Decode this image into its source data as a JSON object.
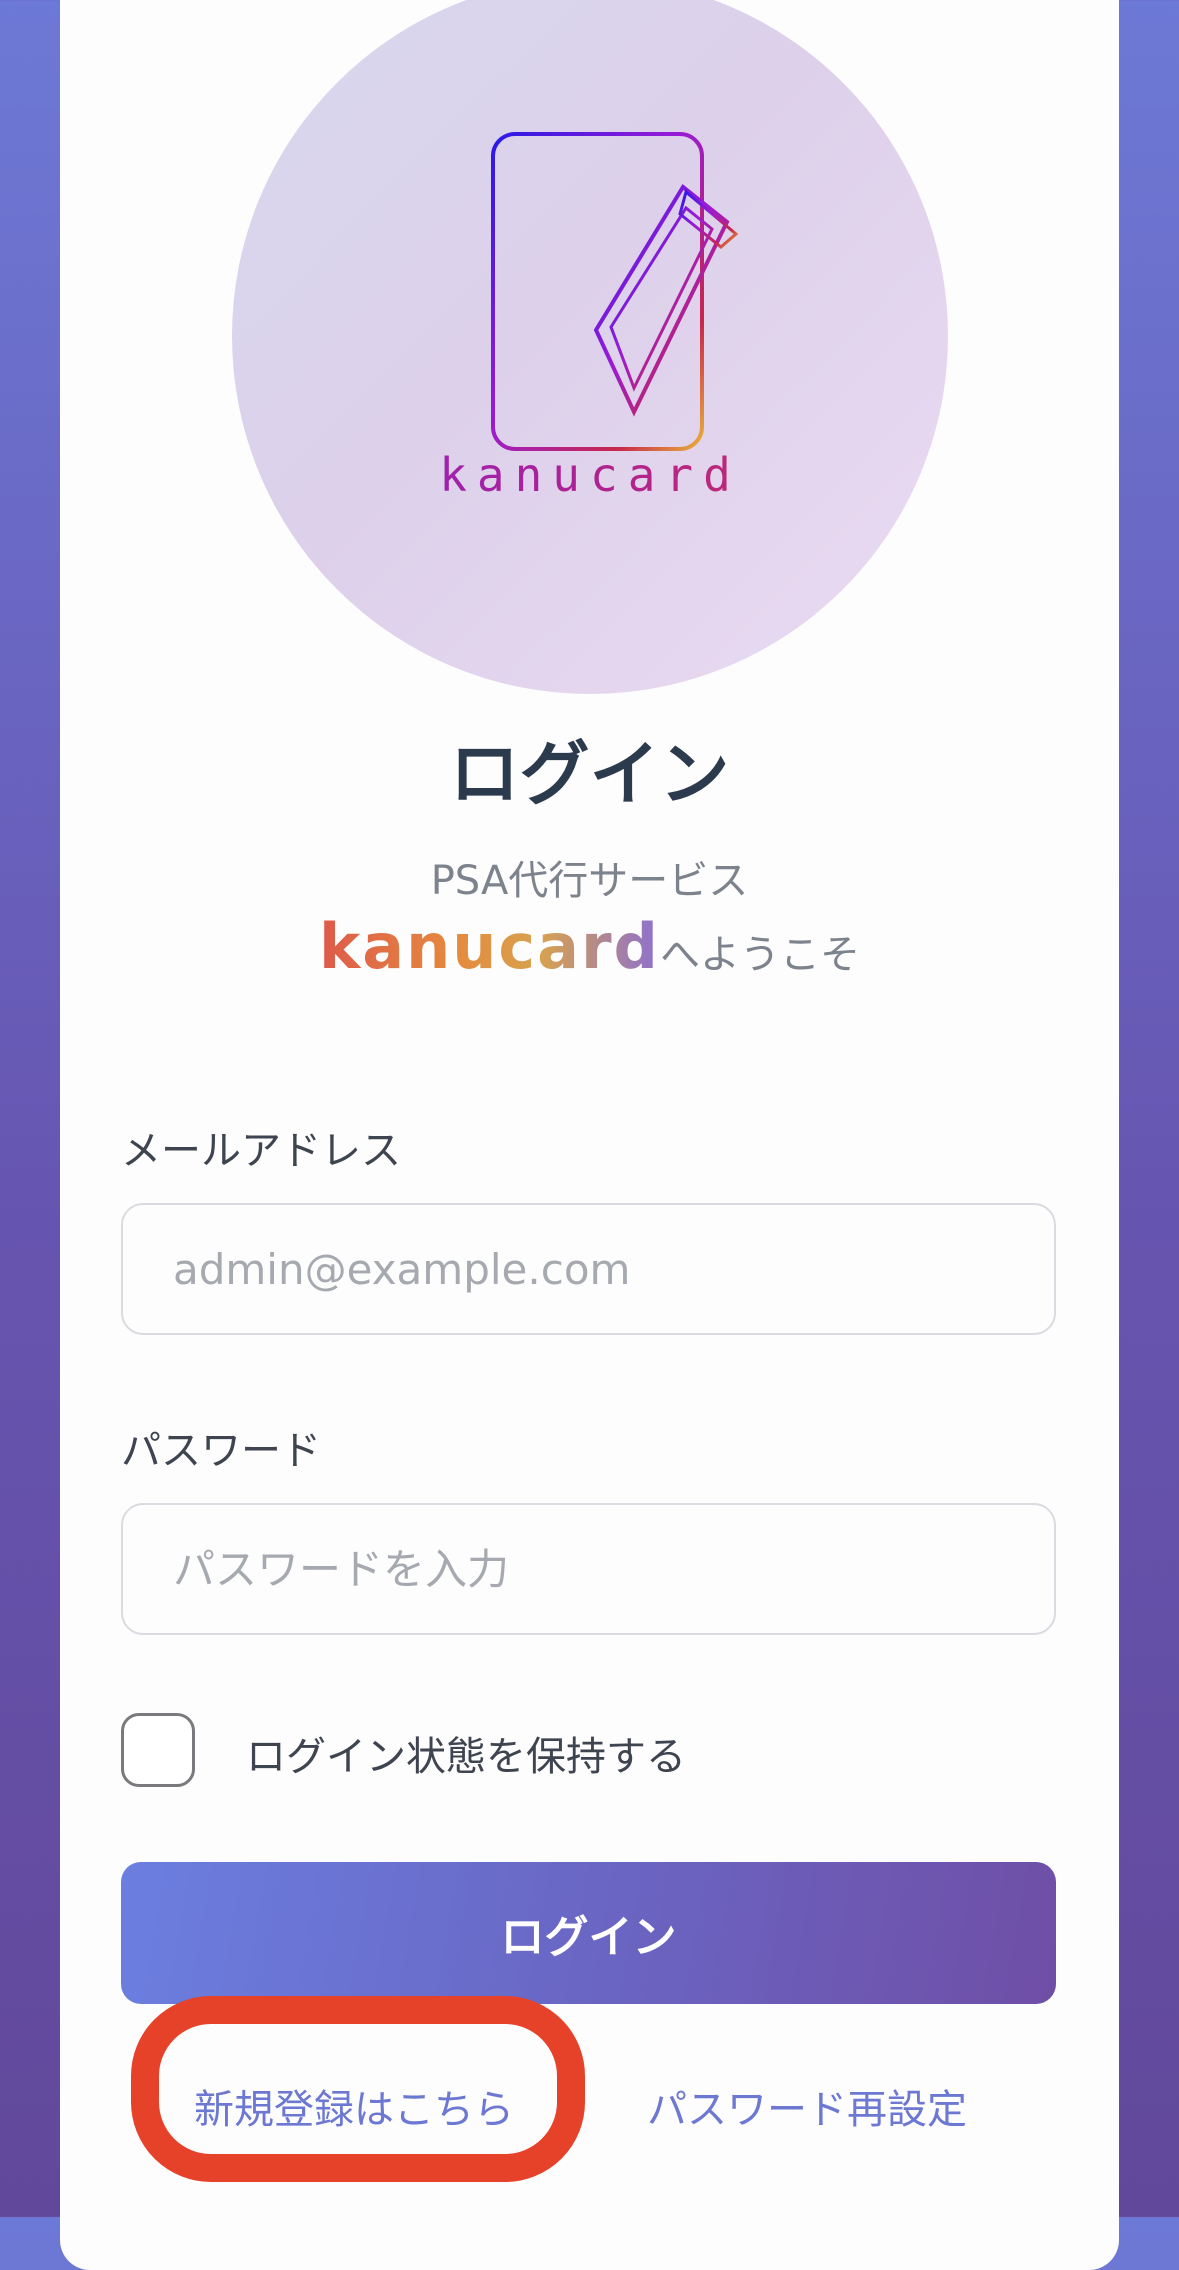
{
  "logo": {
    "brand_text": "kanucard",
    "icon_name": "card-logo-icon"
  },
  "title": "ログイン",
  "subtitle": "PSA代行サービス",
  "welcome": {
    "brand": "kanucard",
    "suffix": "へようこそ"
  },
  "email": {
    "label": "メールアドレス",
    "placeholder": "admin@example.com",
    "value": ""
  },
  "password": {
    "label": "パスワード",
    "placeholder": "パスワードを入力",
    "value": ""
  },
  "remember": {
    "label": "ログイン状態を保持する",
    "checked": false
  },
  "login_button": "ログイン",
  "links": {
    "register": "新規登録はこちら",
    "reset_password": "パスワード再設定"
  },
  "colors": {
    "accent": "#6c78d2",
    "highlight": "#e6422a",
    "title": "#2c3a4d"
  }
}
